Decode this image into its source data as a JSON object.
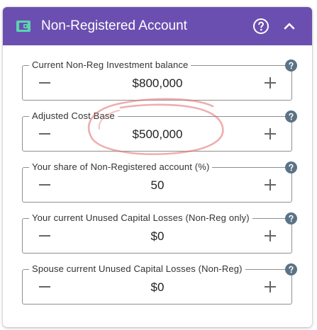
{
  "header": {
    "title": "Non-Registered Account",
    "icon": "wallet-icon",
    "help_icon": "help-circle-icon",
    "collapse_icon": "chevron-up-icon",
    "background_color": "#6b4fb0"
  },
  "fields": [
    {
      "label": "Current Non-Reg Investment balance",
      "value": "$800,000"
    },
    {
      "label": "Adjusted Cost Base",
      "value": "$500,000"
    },
    {
      "label": "Your share of Non-Registered account (%)",
      "value": "50"
    },
    {
      "label": "Your current Unused Capital Losses (Non-Reg only)",
      "value": "$0"
    },
    {
      "label": "Spouse current Unused Capital Losses (Non-Reg)",
      "value": "$0"
    }
  ],
  "colors": {
    "accent": "#6b4fb0",
    "wallet_icon": "#5ad3b0",
    "help_dot": "#5b7386",
    "annotation_circle": "#e06b6b"
  }
}
